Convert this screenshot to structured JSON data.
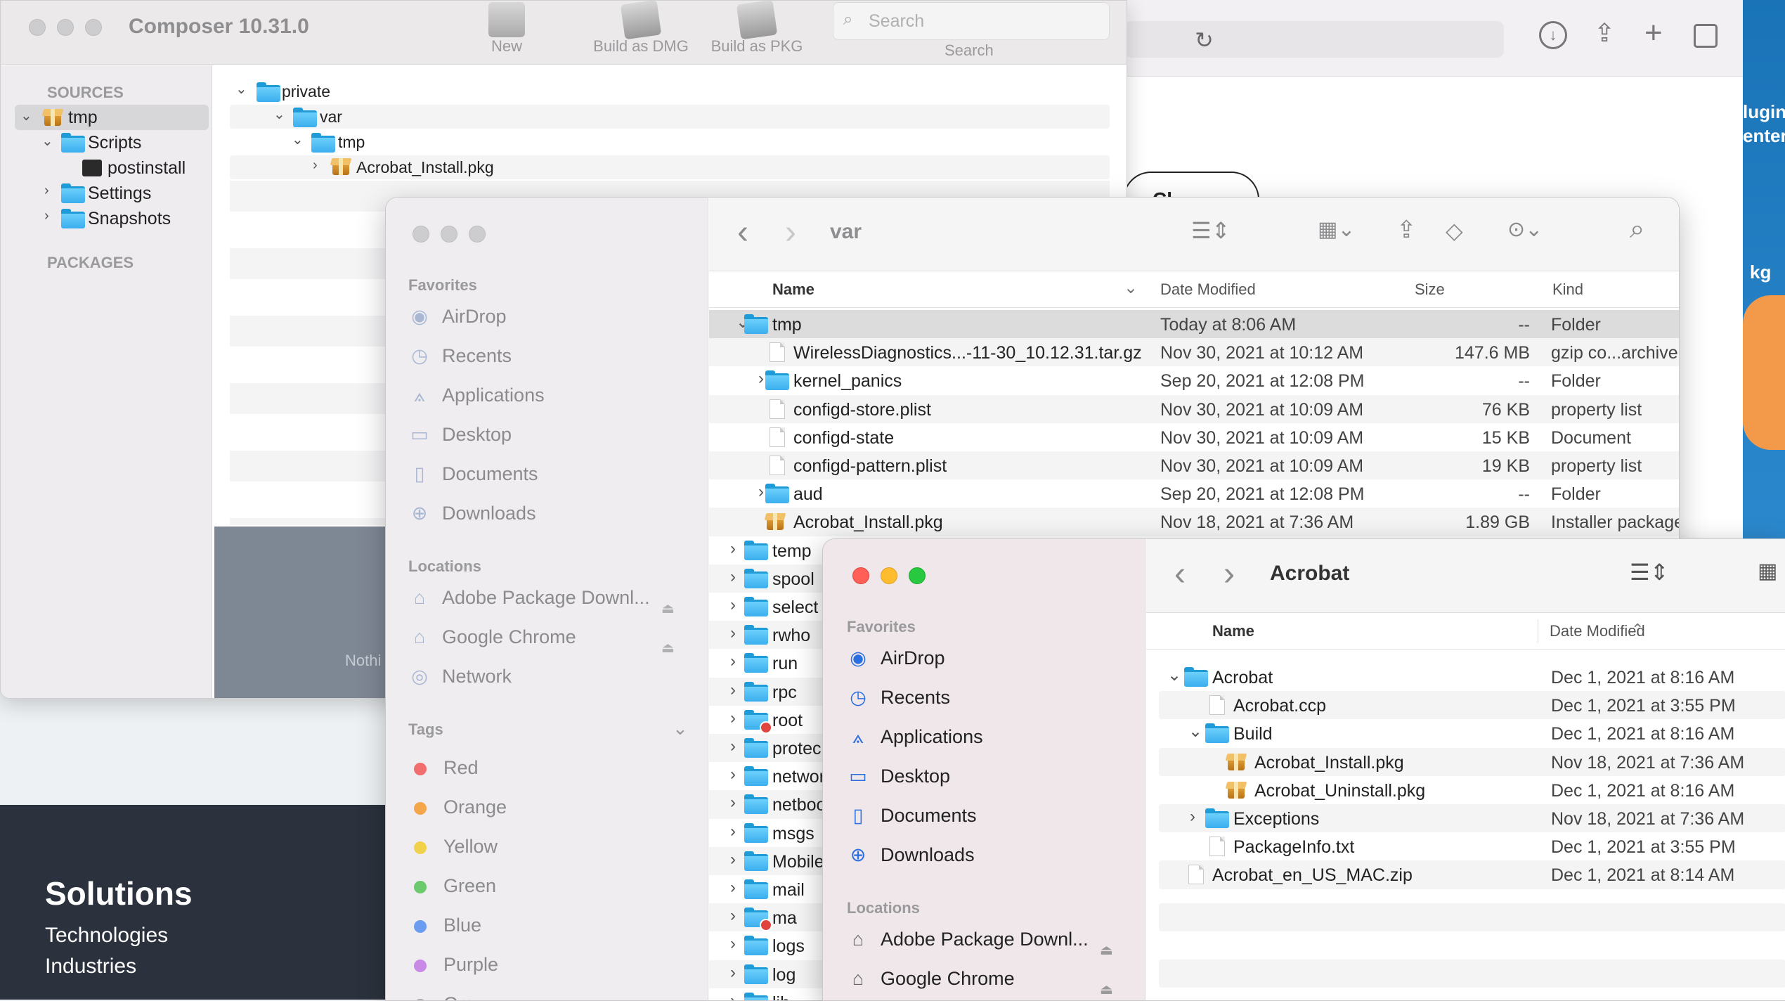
{
  "composer": {
    "title": "Composer 10.31.0",
    "toolbar": {
      "new": "New",
      "build_dmg": "Build as DMG",
      "build_pkg": "Build as PKG",
      "search_placeholder": "Search",
      "search_label": "Search"
    },
    "sources_header": "SOURCES",
    "packages_header": "PACKAGES",
    "tree": {
      "tmp": "tmp",
      "scripts": "Scripts",
      "postinstall": "postinstall",
      "settings": "Settings",
      "snapshots": "Snapshots"
    },
    "content_tree": {
      "private": "private",
      "var": "var",
      "tmp": "tmp",
      "pkg": "Acrobat_Install.pkg"
    },
    "footer_partial": "Nothi"
  },
  "browser": {
    "right_text_1": "lugin",
    "right_text_2": "enter",
    "right_text_3": "kg",
    "left_text": "Cl",
    "solutions": "Solutions",
    "technologies": "Technologies",
    "industries": "Industries"
  },
  "finder_var": {
    "title": "var",
    "favorites_header": "Favorites",
    "favorites": [
      "AirDrop",
      "Recents",
      "Applications",
      "Desktop",
      "Documents",
      "Downloads"
    ],
    "locations_header": "Locations",
    "locations": [
      "Adobe Package Downl...",
      "Google Chrome",
      "Network"
    ],
    "tags_header": "Tags",
    "tags": [
      {
        "name": "Red",
        "color": "#f26d6d"
      },
      {
        "name": "Orange",
        "color": "#f5a54a"
      },
      {
        "name": "Yellow",
        "color": "#f2d14a"
      },
      {
        "name": "Green",
        "color": "#6cc96c"
      },
      {
        "name": "Blue",
        "color": "#6a9df2"
      },
      {
        "name": "Purple",
        "color": "#c88ae6"
      },
      {
        "name": "Gray",
        "color": "#aaaaaa"
      }
    ],
    "columns": {
      "name": "Name",
      "date": "Date Modified",
      "size": "Size",
      "kind": "Kind"
    },
    "rows": [
      {
        "name": "tmp",
        "date": "Today at 8:06 AM",
        "size": "--",
        "kind": "Folder"
      },
      {
        "name": "WirelessDiagnostics...-11-30_10.12.31.tar.gz",
        "date": "Nov 30, 2021 at 10:12 AM",
        "size": "147.6 MB",
        "kind": "gzip co...archive"
      },
      {
        "name": "kernel_panics",
        "date": "Sep 20, 2021 at 12:08 PM",
        "size": "--",
        "kind": "Folder"
      },
      {
        "name": "configd-store.plist",
        "date": "Nov 30, 2021 at 10:09 AM",
        "size": "76 KB",
        "kind": "property list"
      },
      {
        "name": "configd-state",
        "date": "Nov 30, 2021 at 10:09 AM",
        "size": "15 KB",
        "kind": "Document"
      },
      {
        "name": "configd-pattern.plist",
        "date": "Nov 30, 2021 at 10:09 AM",
        "size": "19 KB",
        "kind": "property list"
      },
      {
        "name": "aud",
        "date": "Sep 20, 2021 at 12:08 PM",
        "size": "--",
        "kind": "Folder"
      },
      {
        "name": "Acrobat_Install.pkg",
        "date": "Nov 18, 2021 at 7:36 AM",
        "size": "1.89 GB",
        "kind": "Installer package"
      }
    ],
    "more_rows": [
      "temp",
      "spool",
      "select",
      "rwho",
      "run",
      "rpc",
      "root",
      "protec",
      "networ",
      "netboo",
      "msgs",
      "Mobile",
      "mail",
      "ma",
      "logs",
      "log",
      "lib"
    ]
  },
  "finder_acrobat": {
    "title": "Acrobat",
    "favorites_header": "Favorites",
    "favorites": [
      "AirDrop",
      "Recents",
      "Applications",
      "Desktop",
      "Documents",
      "Downloads"
    ],
    "locations_header": "Locations",
    "locations": [
      "Adobe Package Downl...",
      "Google Chrome"
    ],
    "columns": {
      "name": "Name",
      "date": "Date Modified"
    },
    "rows": [
      {
        "name": "Acrobat",
        "date": "Dec 1, 2021 at 8:16 AM"
      },
      {
        "name": "Acrobat.ccp",
        "date": "Dec 1, 2021 at 3:55 PM"
      },
      {
        "name": "Build",
        "date": "Dec 1, 2021 at 8:16 AM"
      },
      {
        "name": "Acrobat_Install.pkg",
        "date": "Nov 18, 2021 at 7:36 AM"
      },
      {
        "name": "Acrobat_Uninstall.pkg",
        "date": "Dec 1, 2021 at 8:16 AM"
      },
      {
        "name": "Exceptions",
        "date": "Nov 18, 2021 at 7:36 AM"
      },
      {
        "name": "PackageInfo.txt",
        "date": "Dec 1, 2021 at 3:55 PM"
      },
      {
        "name": "Acrobat_en_US_MAC.zip",
        "date": "Dec 1, 2021 at 8:14 AM"
      }
    ]
  }
}
